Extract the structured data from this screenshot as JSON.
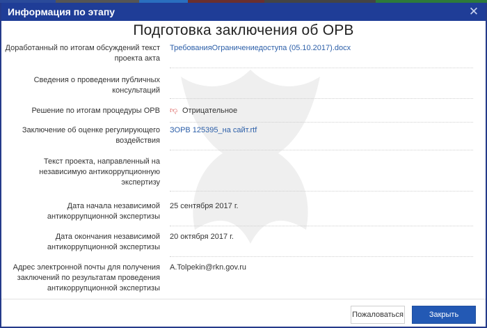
{
  "dialog": {
    "title": "Информация по этапу",
    "heading": "Подготовка заключения об ОРВ"
  },
  "fields": [
    {
      "label": "Доработанный по итогам обсуждений текст проекта акта",
      "value": "ТребованияОграничениедоступа (05.10.2017).docx",
      "value_type": "link"
    },
    {
      "label": "Сведения о проведении публичных консультаций",
      "value": "",
      "value_type": "text"
    },
    {
      "label": "Решение по итогам процедуры ОРВ",
      "value": "Отрицательное",
      "value_type": "status",
      "icon": "thumbs-down-icon"
    },
    {
      "label": "Заключение об оценке регулирующего воздействия",
      "value": "ЗОРВ 125395_на сайт.rtf",
      "value_type": "link"
    },
    {
      "label": "Текст проекта, направленный на независимую антикоррупционную экспертизу",
      "value": "",
      "value_type": "text"
    },
    {
      "label": "Дата начала независимой антикоррупционной экспертизы",
      "value": "25 сентября 2017 г.",
      "value_type": "text"
    },
    {
      "label": "Дата окончания независимой антикоррупционной экспертизы",
      "value": "20 октября 2017 г.",
      "value_type": "text"
    },
    {
      "label": "Адрес электронной почты для получения заключений по результатам проведения антикоррупционной экспертизы",
      "value": "A.Tolpekin@rkn.gov.ru",
      "value_type": "text"
    }
  ],
  "footer": {
    "complain_label": "Пожаловаться",
    "close_label": "Закрыть"
  },
  "colors": {
    "header_bg": "#1f3d97",
    "primary_button": "#2359b4",
    "link": "#2b5ea8",
    "negative": "#d9534f"
  }
}
